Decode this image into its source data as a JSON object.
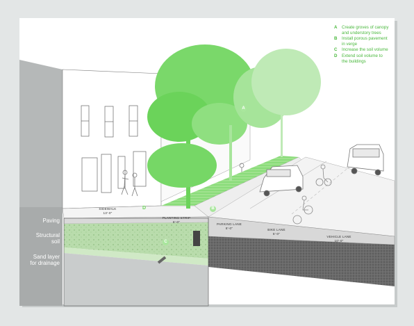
{
  "legend": [
    {
      "key": "A",
      "text": "Create groves of canopy\nand understory trees"
    },
    {
      "key": "B",
      "text": "Install porous pavement\nin verge"
    },
    {
      "key": "C",
      "text": "Increase the soil volume"
    },
    {
      "key": "D",
      "text": "Extend soil volume to\nthe buildings"
    }
  ],
  "layers": {
    "paving": "Paving",
    "structural_soil": "Structural\nsoil",
    "sand": "Sand layer\nfor drainage"
  },
  "zones": {
    "sidewalk": "SIDEWALK",
    "sidewalk_dim": "13'-0\"",
    "planting": "PLANTING STRIP",
    "planting_dim": "6'-0\"",
    "parking": "PARKING LANE",
    "parking_dim": "8'-0\"",
    "bike": "BIKE LANE",
    "bike_dim": "5'-0\"",
    "vehicle": "VEHICLE LANE",
    "vehicle_dim": "10'-0\""
  },
  "markers": {
    "a": "A",
    "b": "B",
    "c": "C",
    "d": "D"
  },
  "colors": {
    "green": "#6bd35a",
    "legend_green": "#49b83c",
    "soil": "#b9dcac",
    "road": "#5e5e5e",
    "background": "#e3e6e6",
    "paper": "#ffffff"
  }
}
